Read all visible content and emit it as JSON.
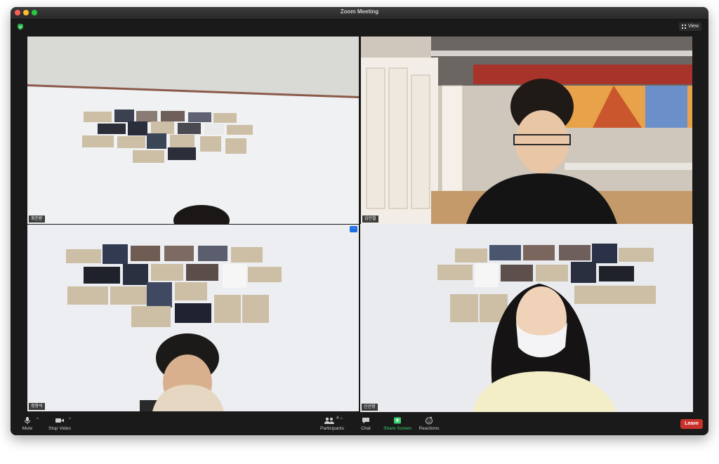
{
  "window": {
    "title": "Zoom Meeting"
  },
  "topbar": {
    "view_label": "View"
  },
  "participants": [
    {
      "name": "최진환"
    },
    {
      "name": "김민철"
    },
    {
      "name": "정용석"
    },
    {
      "name": "신선영"
    }
  ],
  "toolbar": {
    "mute_label": "Mute",
    "stop_video_label": "Stop Video",
    "participants_label": "Participants",
    "participants_count": "4",
    "chat_label": "Chat",
    "share_screen_label": "Share Screen",
    "reactions_label": "Reactions",
    "leave_label": "Leave"
  },
  "colors": {
    "active_speaker_border": "#cfe34b",
    "share_screen_green": "#3bd16f",
    "leave_red": "#c9322a",
    "tile_menu_blue": "#1d6fe6"
  }
}
